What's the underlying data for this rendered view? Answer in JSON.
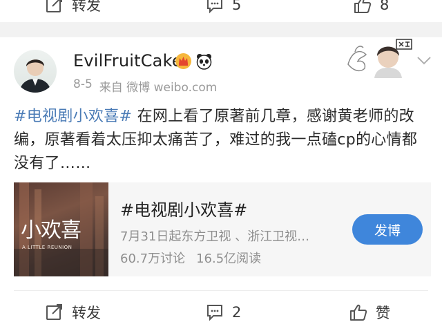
{
  "top_actions": {
    "repost_label": "转发",
    "comment_count": "5",
    "like_count": "8"
  },
  "post": {
    "username": "EvilFruitCake",
    "date": "8-5",
    "source": "来自 微博 weibo.com",
    "topic_tag": "#电视剧小欢喜#",
    "text": " 在网上看了原著前几章，感谢黄老师的改编，原著看着太压抑太痛苦了，难过的我一点磕cp的心情都没有了……",
    "badges": [
      "crown-badge-icon",
      "panda-badge-icon"
    ]
  },
  "topic_card": {
    "thumb_title": "小欢喜",
    "thumb_subtitle": "A LITTLE REUNION",
    "title": "#电视剧小欢喜#",
    "subtitle": "7月31日起东方卫视 、浙江卫视…",
    "discussions": "60.7万讨论",
    "reads": "16.5亿阅读",
    "button_label": "发博"
  },
  "bottom_actions": {
    "repost_label": "转发",
    "comment_count": "2",
    "like_label": "赞"
  },
  "colors": {
    "link": "#4a7bb6",
    "button": "#3f86db",
    "separator": "#f2f2f2"
  }
}
